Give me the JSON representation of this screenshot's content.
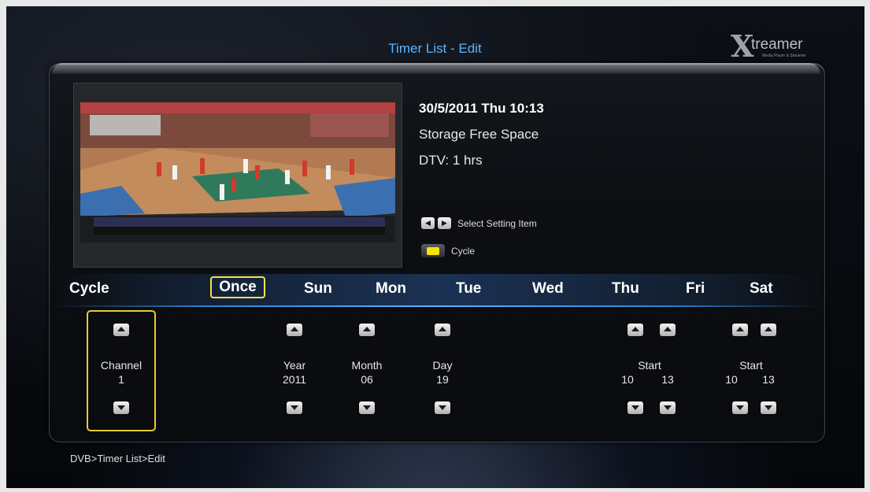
{
  "header": {
    "title": "Timer List - Edit"
  },
  "logo": {
    "text": "treamer",
    "subtitle": "Media Player & Streamer"
  },
  "info": {
    "datetime": "30/5/2011 Thu 10:13",
    "storage": "Storage Free Space",
    "dtv": "DTV: 1 hrs"
  },
  "hints": {
    "select": "Select Setting Item",
    "cycle": "Cycle"
  },
  "days": {
    "cycle_label": "Cycle",
    "selected": "Once",
    "sun": "Sun",
    "mon": "Mon",
    "tue": "Tue",
    "wed": "Wed",
    "thu": "Thu",
    "fri": "Fri",
    "sat": "Sat"
  },
  "fields": {
    "channel": {
      "label": "Channel",
      "value": "1"
    },
    "year": {
      "label": "Year",
      "value": "2011"
    },
    "month": {
      "label": "Month",
      "value": "06"
    },
    "day": {
      "label": "Day",
      "value": "19"
    },
    "start": {
      "label": "Start",
      "hour": "10",
      "minute": "13"
    },
    "start2": {
      "label": "Start",
      "hour": "10",
      "minute": "13"
    }
  },
  "breadcrumb": "DVB>Timer List>Edit",
  "colors": {
    "title": "#59b5ff",
    "focus": "#f6e34a",
    "yellow_key": "#f6e500",
    "accent_line": "#5ab4ff"
  }
}
